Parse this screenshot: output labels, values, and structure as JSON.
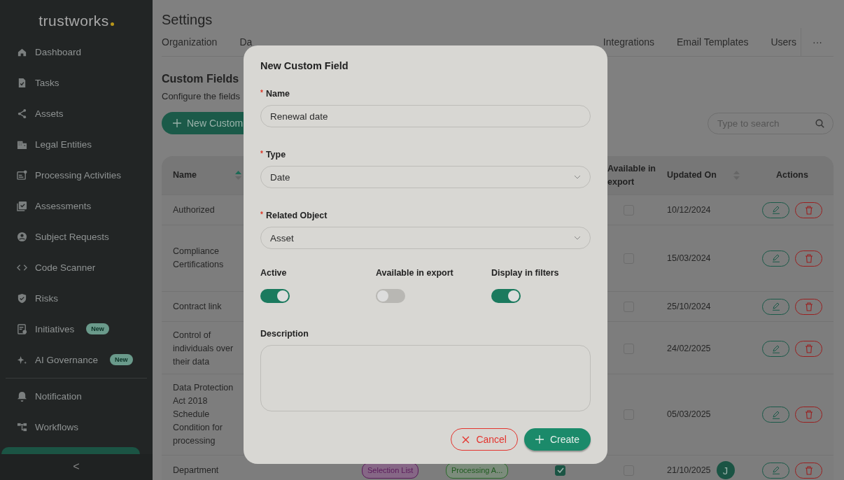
{
  "sidebar": {
    "logo": "trustworks",
    "items": [
      {
        "label": "Dashboard",
        "selected": false
      },
      {
        "label": "Tasks",
        "selected": false
      },
      {
        "label": "Assets",
        "selected": false
      },
      {
        "label": "Legal Entities",
        "selected": false
      },
      {
        "label": "Processing Activities",
        "selected": false
      },
      {
        "label": "Assessments",
        "selected": false
      },
      {
        "label": "Subject Requests",
        "selected": false
      },
      {
        "label": "Code Scanner",
        "selected": false
      },
      {
        "label": "Risks",
        "selected": false
      },
      {
        "label": "Initiatives",
        "badge": "New",
        "selected": false
      },
      {
        "label": "AI Governance",
        "badge": "New",
        "selected": false
      }
    ],
    "secondary_items": [
      {
        "label": "Notification",
        "selected": false
      },
      {
        "label": "Workflows",
        "selected": false
      },
      {
        "selected": true
      }
    ],
    "collapse": "<"
  },
  "page": {
    "title": "Settings",
    "tabs": [
      {
        "label": "Organization",
        "kind": "tab"
      },
      {
        "label": "Da",
        "kind": "cut"
      },
      {
        "label": "Integrations",
        "kind": "tab"
      },
      {
        "label": "Email Templates",
        "kind": "tab"
      },
      {
        "label": "Users",
        "kind": "tab"
      },
      {
        "label": "···",
        "kind": "more"
      }
    ],
    "section_title": "Custom Fields",
    "section_description": "Configure the fields",
    "new_button": "New Custom",
    "search": {
      "placeholder": "Type to search"
    }
  },
  "table": {
    "columns": {
      "name": "Name",
      "export": "Available in export",
      "updated": "Updated On",
      "actions": "Actions"
    },
    "rows": [
      {
        "name": "Authorized",
        "export_checked": false,
        "updated": "10/12/2024"
      },
      {
        "name": "Compliance Certifications",
        "export_checked": false,
        "updated": "15/03/2024"
      },
      {
        "name": "Contract link",
        "export_checked": false,
        "updated": "25/10/2024"
      },
      {
        "name": "Control of individuals over their data",
        "export_checked": false,
        "updated": "24/02/2025"
      },
      {
        "name": "Data Protection Act 2018 Schedule Condition for processing",
        "export_checked": false,
        "updated": "05/03/2025"
      },
      {
        "name": "Department",
        "type": "Selection List",
        "object": "Processing A...",
        "active_checked": true,
        "export_checked": false,
        "updated": "21/10/2025",
        "avatar": "J"
      }
    ]
  },
  "dialog": {
    "title": "New Custom Field",
    "name": {
      "label": "Name",
      "required_mark": "*",
      "value": "Renewal date"
    },
    "type": {
      "label": "Type",
      "required_mark": "*",
      "value": "Date"
    },
    "related_object": {
      "label": "Related Object",
      "required_mark": "*",
      "value": "Asset"
    },
    "toggles": [
      {
        "label": "Active",
        "on": true
      },
      {
        "label": "Available in export",
        "on": false
      },
      {
        "label": "Display in filters",
        "on": true
      }
    ],
    "description": {
      "label": "Description"
    },
    "cancel": "Cancel",
    "create": "Create"
  }
}
